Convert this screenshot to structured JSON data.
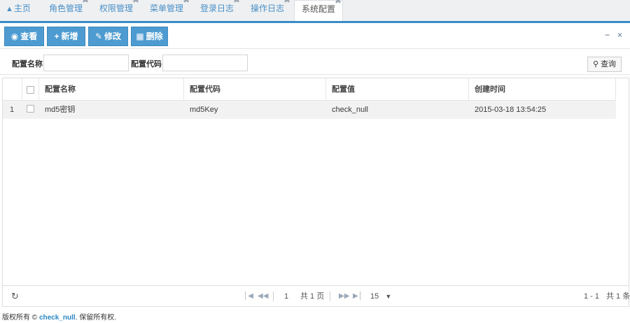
{
  "tabs": [
    {
      "label": "主页",
      "icon": "home-icon",
      "closable": false,
      "active": false
    },
    {
      "label": "角色管理",
      "closable": true,
      "active": false
    },
    {
      "label": "权限管理",
      "closable": true,
      "active": false
    },
    {
      "label": "菜单管理",
      "closable": true,
      "active": false
    },
    {
      "label": "登录日志",
      "closable": true,
      "active": false
    },
    {
      "label": "操作日志",
      "closable": true,
      "active": false
    },
    {
      "label": "系统配置",
      "closable": true,
      "active": true
    }
  ],
  "close_glyph": "✖",
  "toolbar": {
    "view_label": "查看",
    "add_label": "新增",
    "edit_label": "修改",
    "delete_label": "删除",
    "minimize_glyph": "−",
    "close_glyph": "×",
    "button_color": "#4d9bd0",
    "accent_color": "#3a8cc7"
  },
  "search": {
    "name_label": "配置名称:",
    "name_value": "",
    "code_label": "配置代码:",
    "code_value": "",
    "query_label": "查询"
  },
  "grid": {
    "columns": [
      "配置名称",
      "配置代码",
      "配置值",
      "创建时间"
    ],
    "rows": [
      {
        "num": "1",
        "name": "md5密钥",
        "code": "md5Key",
        "value": "check_null",
        "created": "2015-03-18 13:54:25"
      }
    ]
  },
  "pager": {
    "page": "1",
    "total_pages": "共 1 页",
    "page_size": "15",
    "range": "1 - 1",
    "total": "共 1 条"
  },
  "footer": {
    "prefix": "版权所有 © ",
    "brand": "check_null",
    "suffix": ". 保留所有权."
  }
}
